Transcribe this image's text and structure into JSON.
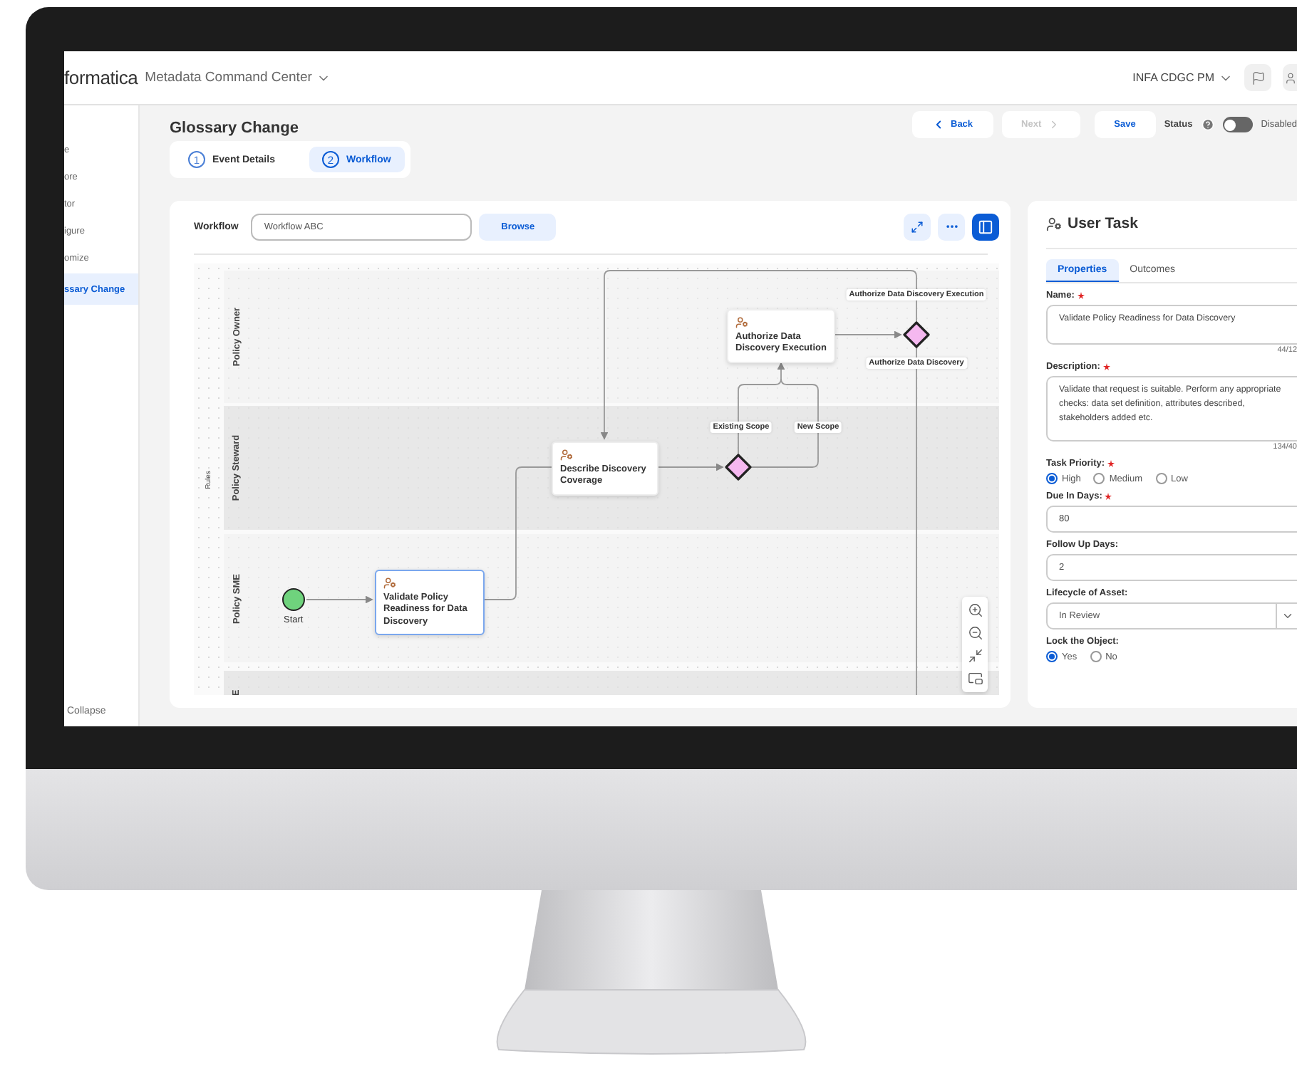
{
  "app": {
    "brand": "formatica",
    "product": "Metadata Command Center",
    "user": "INFA CDGC PM"
  },
  "sidebar": {
    "items": [
      {
        "label": "e",
        "selected": false
      },
      {
        "label": "ore",
        "selected": false
      },
      {
        "label": "tor",
        "selected": false
      },
      {
        "label": "igure",
        "selected": false
      },
      {
        "label": "omize",
        "selected": false
      },
      {
        "label": "ssary Change",
        "selected": true
      }
    ],
    "collapse": "Collapse"
  },
  "page": {
    "title": "Glossary Change",
    "steps": [
      {
        "number": "1",
        "label": "Event Details",
        "selected": false
      },
      {
        "number": "2",
        "label": "Workflow",
        "selected": true
      }
    ],
    "actions": [
      {
        "kind": "back",
        "label": "Back",
        "disabled": false
      },
      {
        "kind": "next",
        "label": "Next",
        "disabled": true
      },
      {
        "kind": "save",
        "label": "Save",
        "disabled": false
      }
    ],
    "status": {
      "label": "Status",
      "on": false,
      "value": "Disabled"
    }
  },
  "workflow": {
    "label": "Workflow",
    "value": "Workflow ABC",
    "browse": "Browse"
  },
  "diagram": {
    "rules_label": "Rules",
    "lanes": [
      {
        "label": "Policy Owner"
      },
      {
        "label": "Policy Steward"
      },
      {
        "label": "Policy SME"
      },
      {
        "label": "E"
      }
    ],
    "start": "Start",
    "tasks": [
      {
        "label": "Validate Policy Readiness for Data Discovery",
        "selected": true
      },
      {
        "label": "Describe Discovery Coverage",
        "selected": false
      },
      {
        "label": "Authorize Data Discovery Execution",
        "selected": false
      }
    ],
    "edge_labels": [
      "Authorize Data Discovery Execution",
      "Authorize Data Discovery",
      "Existing Scope",
      "New Scope"
    ]
  },
  "panel": {
    "title": "User Task",
    "tabs": [
      {
        "label": "Properties",
        "selected": true
      },
      {
        "label": "Outcomes",
        "selected": false
      }
    ],
    "fields": [
      {
        "kind": "textarea",
        "label": "Name:",
        "required": true,
        "value": "Validate Policy Readiness for Data Discovery",
        "counter": "44/12"
      },
      {
        "kind": "textarea",
        "label": "Description:",
        "required": true,
        "value": "Validate that request is suitable. Perform any appropriate checks: data set definition, attributes described, stakeholders added etc.",
        "counter": "134/40"
      },
      {
        "kind": "radio",
        "label": "Task Priority:",
        "required": true,
        "options": [
          {
            "label": "High",
            "selected": true
          },
          {
            "label": "Medium",
            "selected": false
          },
          {
            "label": "Low",
            "selected": false
          }
        ]
      },
      {
        "kind": "input",
        "label": "Due In Days:",
        "required": true,
        "value": "80"
      },
      {
        "kind": "input",
        "label": "Follow Up Days:",
        "required": false,
        "value": "2"
      },
      {
        "kind": "select",
        "label": "Lifecycle of Asset:",
        "required": false,
        "value": "In Review"
      },
      {
        "kind": "radio",
        "label": "Lock the Object:",
        "required": false,
        "options": [
          {
            "label": "Yes",
            "selected": true
          },
          {
            "label": "No",
            "selected": false
          }
        ]
      }
    ]
  }
}
